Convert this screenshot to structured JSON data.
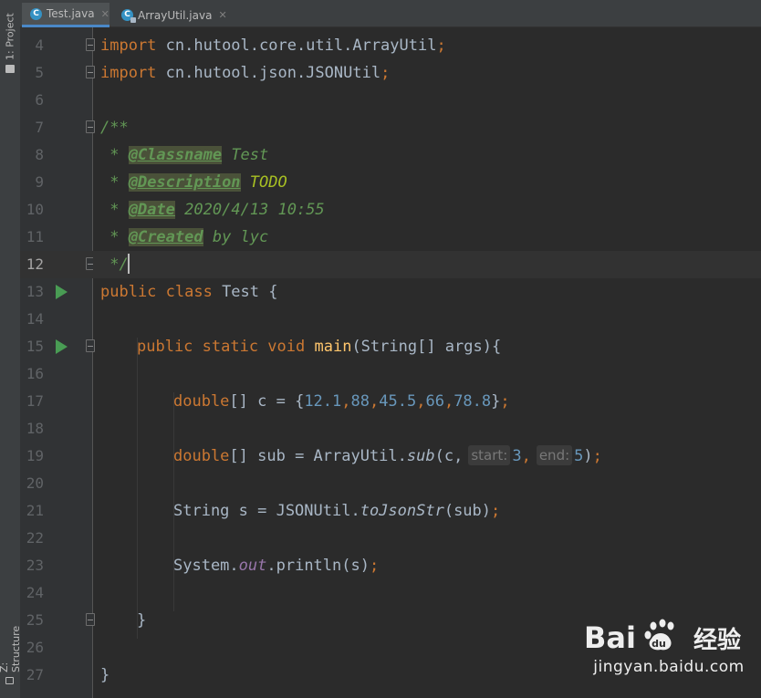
{
  "sidebar": {
    "project_tab": "1: Project",
    "structure_tab": "Z: Structure"
  },
  "tabs": [
    {
      "label": "Test.java",
      "icon": "java-class-icon",
      "active": true
    },
    {
      "label": "ArrayUtil.java",
      "icon": "java-class-icon",
      "active": false
    }
  ],
  "close_glyph": "✕",
  "colors": {
    "background": "#2b2b2b",
    "keyword": "#cc7832",
    "string_plain": "#a9b7c6",
    "doc_comment": "#629755",
    "number": "#6897bb",
    "method_decl": "#ffc66d",
    "run_gutter": "#499c54"
  },
  "editor": {
    "line_numbers": [
      "4",
      "5",
      "6",
      "7",
      "8",
      "9",
      "10",
      "11",
      "12",
      "13",
      "14",
      "15",
      "16",
      "17",
      "18",
      "19",
      "20",
      "21",
      "22",
      "23",
      "24",
      "25",
      "26",
      "27"
    ],
    "current_line": "12",
    "lines": {
      "l4": {
        "kw": "import",
        "rest": " cn.hutool.core.util.ArrayUtil",
        "semi": ";"
      },
      "l5": {
        "kw": "import",
        "rest": " cn.hutool.json.JSONUtil",
        "semi": ";"
      },
      "l7": {
        "text": "/**"
      },
      "l8": {
        "star": " * ",
        "tag": "@Classname",
        "value": " Test"
      },
      "l9": {
        "star": " * ",
        "tag": "@Description",
        "value": "TODO"
      },
      "l10": {
        "star": " * ",
        "tag": "@Date",
        "value": " 2020/4/13 10:55"
      },
      "l11": {
        "star": " * ",
        "tag": "@Created",
        "value": " by lyc"
      },
      "l12": {
        "text": " */"
      },
      "l13": {
        "kw": "public class",
        "rest": " Test {"
      },
      "l15": {
        "kw": "public static void",
        "name": "main",
        "rest": "(String[] args){"
      },
      "l17": {
        "type": "double",
        "rest": "[] c = {",
        "nums": [
          "12.1",
          "88",
          "45.5",
          "66",
          "78.8"
        ],
        "close": "}"
      },
      "l19": {
        "type": "double",
        "rest": "[] sub = ArrayUtil.",
        "method": "sub",
        "arg": "(c,",
        "hint1": "start:",
        "val1": "3",
        "comma": ",",
        "hint2": "end:",
        "val2": "5",
        "end": ")"
      },
      "l21": {
        "rest": "String s = JSONUtil.",
        "method": "toJsonStr",
        "end": "(sub)"
      },
      "l23": {
        "rest": "System.",
        "field": "out",
        "end": ".println(s)"
      },
      "l25": {
        "text": "}"
      },
      "l27": {
        "text": "}"
      }
    }
  },
  "watermark": {
    "logo_text": "Bai",
    "logo_suffix": "经验",
    "url": "jingyan.baidu.com"
  }
}
